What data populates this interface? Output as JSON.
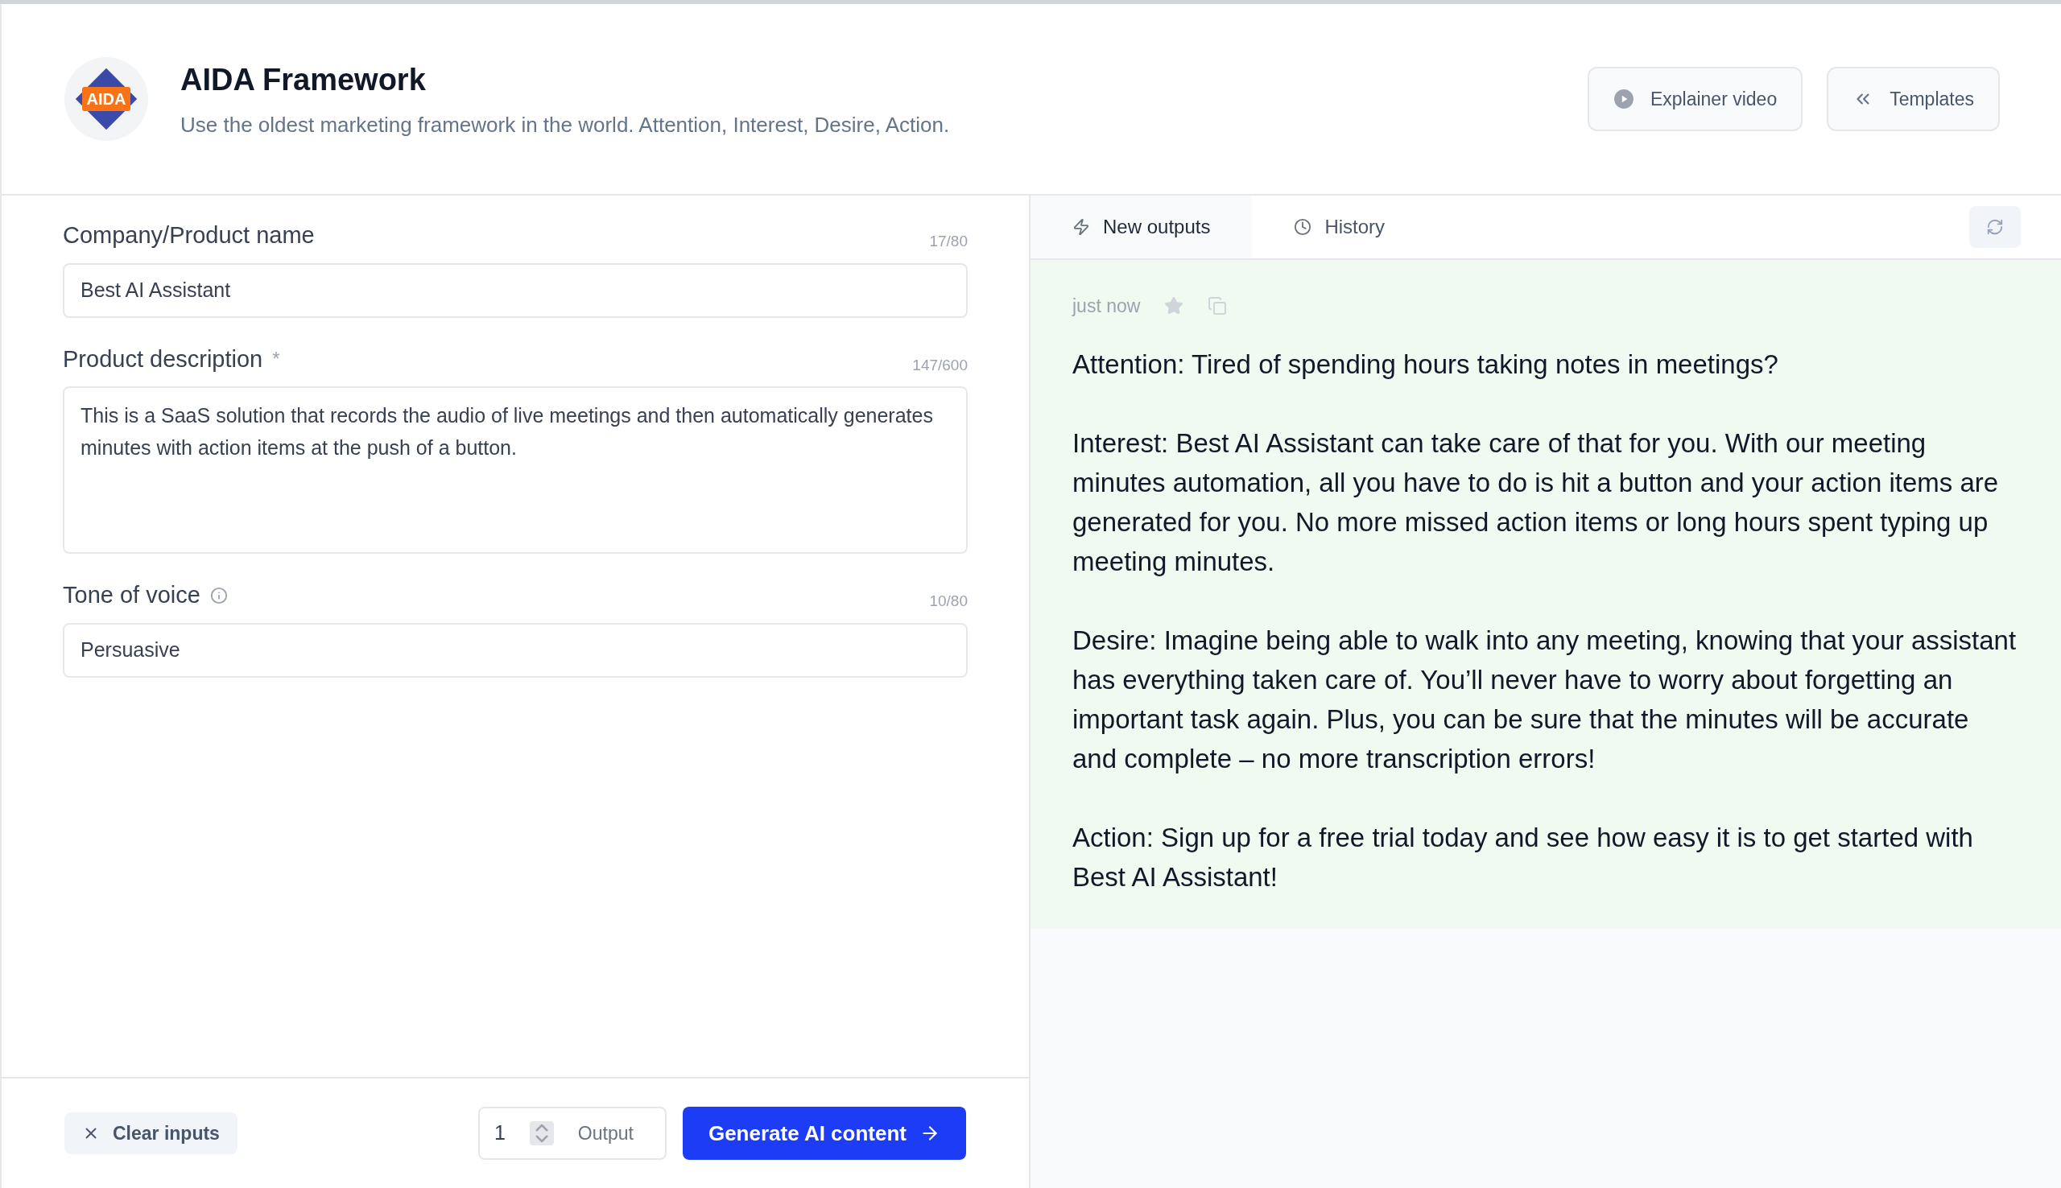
{
  "header": {
    "logo_text": "AIDA",
    "title": "AIDA Framework",
    "subtitle": "Use the oldest marketing framework in the world. Attention, Interest, Desire, Action.",
    "buttons": [
      {
        "kind": "video",
        "label": "Explainer video"
      },
      {
        "kind": "templates",
        "label": "Templates"
      }
    ]
  },
  "form": {
    "fields": [
      {
        "kind": "input",
        "label": "Company/Product name",
        "info": false,
        "counter": "17/80",
        "value": "Best AI Assistant"
      },
      {
        "kind": "textarea",
        "label": "Product description",
        "required_mark": "*",
        "info": false,
        "counter": "147/600",
        "value": "This is a SaaS solution that records the audio of live meetings and then automatically generates minutes with action items at the push of a button."
      },
      {
        "kind": "input",
        "label": "Tone of voice",
        "info": true,
        "counter": "10/80",
        "value": "Persuasive"
      }
    ]
  },
  "footer": {
    "clear_label": "Clear inputs",
    "output_count": "1",
    "output_label": "Output",
    "generate_label": "Generate AI content"
  },
  "output_panel": {
    "tabs": [
      {
        "kind": "new",
        "label": "New outputs",
        "selected": true
      },
      {
        "kind": "history",
        "label": "History",
        "selected": false
      }
    ],
    "result": {
      "time": "just now",
      "starred": false,
      "paragraphs": [
        "Attention: Tired of spending hours taking notes in meetings?",
        "Interest: Best AI Assistant can take care of that for you. With our meeting minutes automation, all you have to do is hit a button and your action items are generated for you. No more missed action items or long hours spent typing up meeting minutes.",
        "Desire: Imagine being able to walk into any meeting, knowing that your assistant has everything taken care of. You’ll never have to worry about forgetting an important task again. Plus, you can be sure that the minutes will be accurate and complete – no more transcription errors!",
        "Action: Sign up for a free trial today and see how easy it is to get started with Best AI Assistant!"
      ]
    }
  }
}
